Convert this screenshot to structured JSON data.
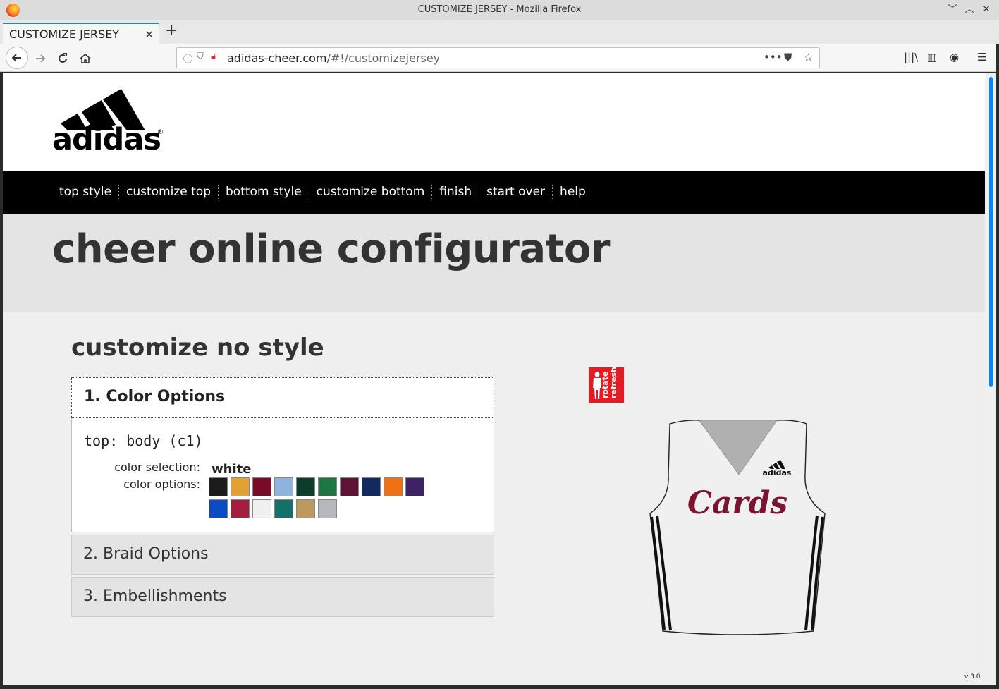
{
  "window": {
    "title": "CUSTOMIZE JERSEY - Mozilla Firefox"
  },
  "tabs": [
    {
      "label": "CUSTOMIZE JERSEY"
    }
  ],
  "url": {
    "domain": "adidas-cheer.com",
    "path": "/#!/customizejersey"
  },
  "brand": {
    "wordmark": "adidas",
    "registered": "®"
  },
  "nav": {
    "items": [
      "top style",
      "customize top",
      "bottom style",
      "customize bottom",
      "finish",
      "start over",
      "help"
    ]
  },
  "banner": {
    "title": "cheer online configurator"
  },
  "page": {
    "subtitle": "customize no style"
  },
  "accordion": {
    "section1": {
      "title": "1. Color Options",
      "part": "top: body (c1)",
      "selection_label": "color selection:",
      "selection_value": "white",
      "options_label": "color options:",
      "swatches": [
        {
          "name": "black",
          "color": "#1c1c1c"
        },
        {
          "name": "gold",
          "color": "#e2a131"
        },
        {
          "name": "maroon",
          "color": "#7a0b27"
        },
        {
          "name": "light-blue",
          "color": "#8fb4de"
        },
        {
          "name": "dark-green",
          "color": "#0c3d2a"
        },
        {
          "name": "kelly-green",
          "color": "#1e7642"
        },
        {
          "name": "burgundy",
          "color": "#5e1437"
        },
        {
          "name": "navy",
          "color": "#132a5e"
        },
        {
          "name": "orange",
          "color": "#f07014"
        },
        {
          "name": "purple",
          "color": "#3e2266"
        },
        {
          "name": "royal-blue",
          "color": "#0b4cc4"
        },
        {
          "name": "cardinal",
          "color": "#a61d3e"
        },
        {
          "name": "white",
          "color": "#f0f0f0"
        },
        {
          "name": "teal",
          "color": "#16706a"
        },
        {
          "name": "vegas-gold",
          "color": "#bb9a5e"
        },
        {
          "name": "silver",
          "color": "#b6b8bd"
        }
      ]
    },
    "section2": {
      "title": "2. Braid Options"
    },
    "section3": {
      "title": "3. Embellishments"
    }
  },
  "preview": {
    "rotate_text": "rotate",
    "refresh_text": "refresh",
    "jersey_text": "Cards",
    "jersey_brand": "adidas",
    "body_color": "#f0f0f0",
    "neck_color": "#b0b0b0",
    "text_color": "#7a1430"
  },
  "footer": {
    "version": "v 3.0"
  }
}
